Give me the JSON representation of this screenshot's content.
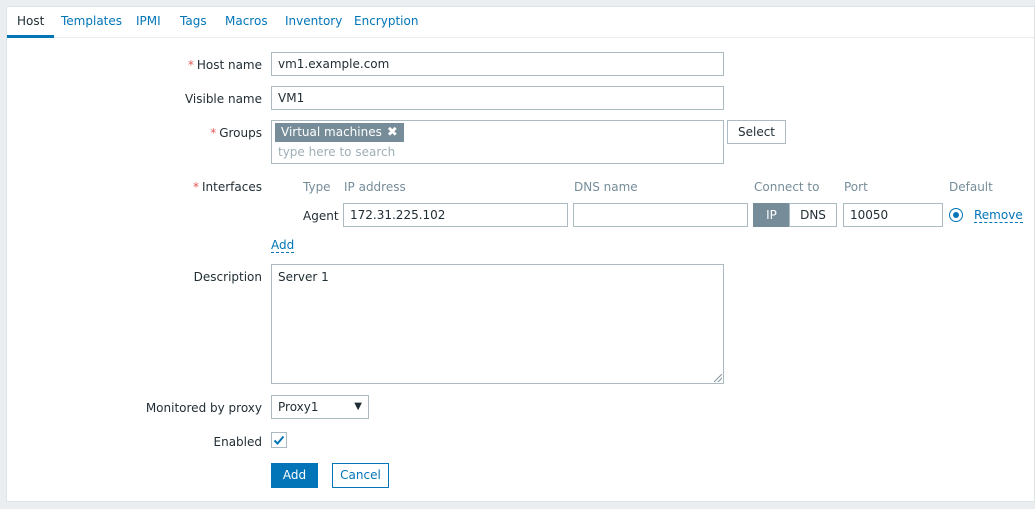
{
  "tabs": [
    {
      "label": "Host",
      "active": true
    },
    {
      "label": "Templates"
    },
    {
      "label": "IPMI"
    },
    {
      "label": "Tags"
    },
    {
      "label": "Macros"
    },
    {
      "label": "Inventory"
    },
    {
      "label": "Encryption"
    }
  ],
  "form": {
    "required_marker": "*",
    "host_name": {
      "label": "Host name",
      "value": "vm1.example.com"
    },
    "visible_name": {
      "label": "Visible name",
      "value": "VM1"
    },
    "groups": {
      "label": "Groups",
      "chips": [
        "Virtual machines"
      ],
      "remove_glyph": "✖",
      "placeholder": "type here to search",
      "select_label": "Select"
    },
    "interfaces": {
      "label": "Interfaces",
      "headers": {
        "type": "Type",
        "ip": "IP address",
        "dns": "DNS name",
        "connect_to": "Connect to",
        "port": "Port",
        "default": "Default"
      },
      "row": {
        "type": "Agent",
        "ip": "172.31.225.102",
        "dns": "",
        "connect_ip": "IP",
        "connect_dns": "DNS",
        "connect_selected": "IP",
        "port": "10050",
        "default_selected": true,
        "remove_label": "Remove"
      },
      "add_label": "Add"
    },
    "description": {
      "label": "Description",
      "value": "Server 1"
    },
    "proxy": {
      "label": "Monitored by proxy",
      "value": "Proxy1",
      "chevron": "▼"
    },
    "enabled": {
      "label": "Enabled",
      "checked": true
    },
    "buttons": {
      "add": "Add",
      "cancel": "Cancel"
    }
  },
  "colors": {
    "accent": "#0275b8",
    "required": "#e45959",
    "chip": "#768d99"
  },
  "icons": {
    "chip_remove": "close-icon",
    "default_radio": "radio-selected-icon",
    "enabled_checkbox": "checkmark-icon",
    "proxy_dropdown": "chevron-down-icon"
  }
}
